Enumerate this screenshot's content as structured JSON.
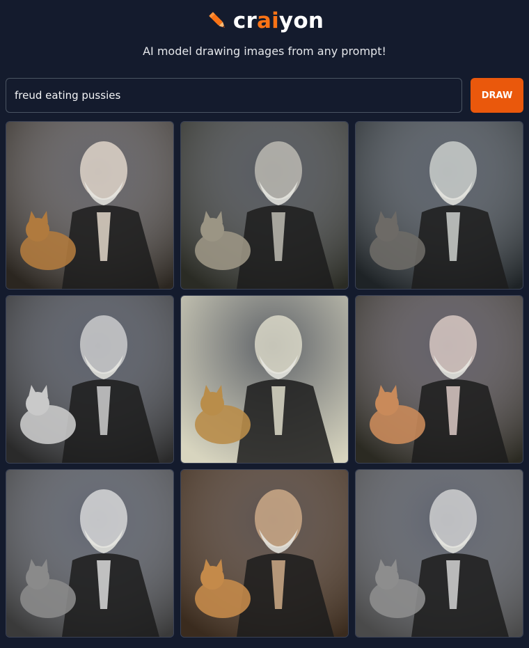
{
  "brand": {
    "name_parts": [
      "cr",
      "ai",
      "yon"
    ],
    "icon": "pencil-icon",
    "accent_color": "#f97316"
  },
  "tagline": "AI model drawing images from any prompt!",
  "prompt": {
    "value": "freud eating pussies",
    "placeholder": ""
  },
  "draw_button": {
    "label": "DRAW",
    "color": "#ea580c"
  },
  "results": [
    {
      "tone": "#2b2620",
      "light": "#efe3d5",
      "cat": "#b07a3e"
    },
    {
      "tone": "#2a2b24",
      "light": "#c8c6bc",
      "cat": "#9b9584"
    },
    {
      "tone": "#1e2326",
      "light": "#d8dcd8",
      "cat": "#6d6a66"
    },
    {
      "tone": "#2a2a2a",
      "light": "#d9d9d9",
      "cat": "#c9c9c9"
    },
    {
      "tone": "#d8d5bf",
      "light": "#e8e6d3",
      "cat": "#b98d4a"
    },
    {
      "tone": "#2b2a22",
      "light": "#e7d5cf",
      "cat": "#c98a5a"
    },
    {
      "tone": "#3a3a3a",
      "light": "#e6e6e6",
      "cat": "#8a8a8a"
    },
    {
      "tone": "#3a2b1e",
      "light": "#d9b48f",
      "cat": "#c48a4a"
    },
    {
      "tone": "#4a4a4a",
      "light": "#dedede",
      "cat": "#8d8d8d"
    }
  ]
}
